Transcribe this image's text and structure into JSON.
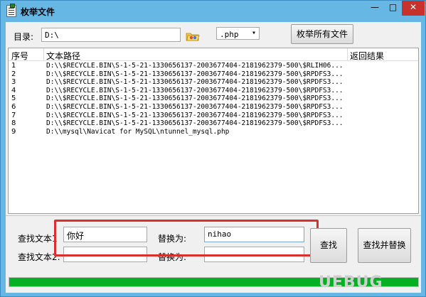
{
  "window": {
    "title": "枚举文件",
    "controls": {
      "minimize": "—",
      "maximize": "□",
      "close": "✕"
    }
  },
  "directory": {
    "label": "目录:",
    "value": "D:\\",
    "browse_icon": "folder-browse-icon"
  },
  "extension": {
    "selected": ".php"
  },
  "enum_button": "枚举所有文件",
  "table": {
    "columns": [
      "序号",
      "文本路径",
      "返回结果"
    ],
    "rows": [
      {
        "index": "1",
        "path": "D:\\\\$RECYCLE.BIN\\S-1-5-21-1330656137-2003677404-2181962379-500\\$RLIH06...",
        "result": ""
      },
      {
        "index": "2",
        "path": "D:\\\\$RECYCLE.BIN\\S-1-5-21-1330656137-2003677404-2181962379-500\\$RPDFS3...",
        "result": ""
      },
      {
        "index": "3",
        "path": "D:\\\\$RECYCLE.BIN\\S-1-5-21-1330656137-2003677404-2181962379-500\\$RPDFS3...",
        "result": ""
      },
      {
        "index": "4",
        "path": "D:\\\\$RECYCLE.BIN\\S-1-5-21-1330656137-2003677404-2181962379-500\\$RPDFS3...",
        "result": ""
      },
      {
        "index": "5",
        "path": "D:\\\\$RECYCLE.BIN\\S-1-5-21-1330656137-2003677404-2181962379-500\\$RPDFS3...",
        "result": ""
      },
      {
        "index": "6",
        "path": "D:\\\\$RECYCLE.BIN\\S-1-5-21-1330656137-2003677404-2181962379-500\\$RPDFS3...",
        "result": ""
      },
      {
        "index": "7",
        "path": "D:\\\\$RECYCLE.BIN\\S-1-5-21-1330656137-2003677404-2181962379-500\\$RPDFS3...",
        "result": ""
      },
      {
        "index": "8",
        "path": "D:\\\\$RECYCLE.BIN\\S-1-5-21-1330656137-2003677404-2181962379-500\\$RPDFS3...",
        "result": ""
      },
      {
        "index": "9",
        "path": "D:\\\\mysql\\Navicat for MySQL\\ntunnel_mysql.php",
        "result": ""
      }
    ]
  },
  "search": {
    "find1_label": "查找文本1",
    "find1_value": "你好",
    "find2_label": "查找文本2:",
    "find2_value": "",
    "replace1_label": "替换为:",
    "replace1_value": "nihao",
    "replace2_label": "替换为:",
    "replace2_value": "",
    "find_button": "查找",
    "find_replace_button": "查找并替换"
  },
  "progress": {
    "percent": 100
  },
  "watermark": "UEBUG",
  "colors": {
    "titlebar": "#66b7e3",
    "progress": "#06b025",
    "highlight": "#d9302c",
    "close": "#c7322b"
  }
}
